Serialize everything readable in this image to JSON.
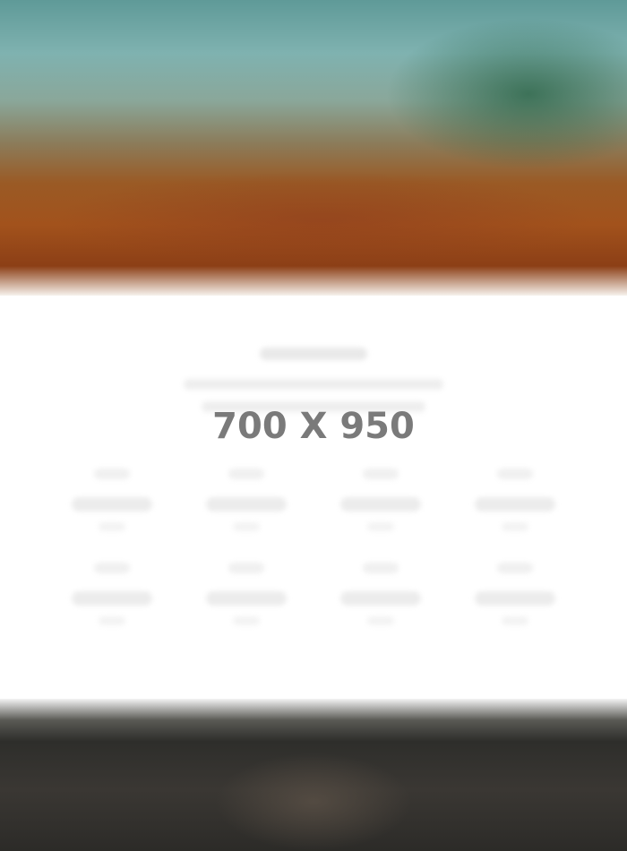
{
  "placeholder": {
    "label": "700 X 950"
  },
  "colors": {
    "hero_top": "#5f9a98",
    "hero_bottom": "#a2521c",
    "placeholder_text": "#7a7a7a",
    "footer": "#2e2e2b"
  }
}
